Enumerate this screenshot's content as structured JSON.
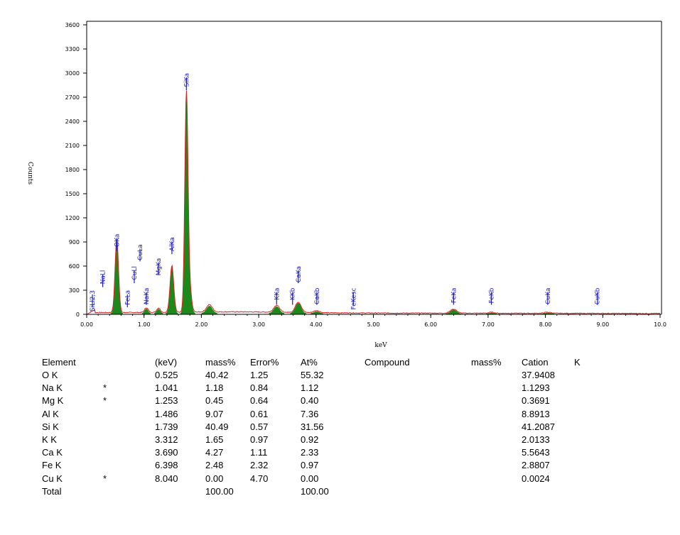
{
  "chart_data": {
    "type": "area",
    "xlabel": "keV",
    "ylabel": "Counts",
    "xlim": [
      0,
      10
    ],
    "ylim": [
      0,
      3600
    ],
    "x_ticks": [
      "0.00",
      "1.00",
      "2.00",
      "3.00",
      "4.00",
      "5.00",
      "6.00",
      "7.00",
      "8.00",
      "9.00",
      "10.0"
    ],
    "y_ticks": [
      "0",
      "300",
      "600",
      "900",
      "1200",
      "1500",
      "1800",
      "2100",
      "2400",
      "2700",
      "3000",
      "3300",
      "3600"
    ],
    "fill_color": "#1b8a1b",
    "line_color": "#e02020",
    "marker_color": "#1a1acc",
    "peaks": [
      {
        "center": 0.525,
        "height": 920,
        "width": 0.03
      },
      {
        "center": 1.041,
        "height": 60,
        "width": 0.03
      },
      {
        "center": 1.253,
        "height": 55,
        "width": 0.03
      },
      {
        "center": 1.486,
        "height": 580,
        "width": 0.032
      },
      {
        "center": 1.739,
        "height": 2720,
        "width": 0.028
      },
      {
        "center": 1.8,
        "height": 260,
        "width": 0.03
      },
      {
        "center": 2.14,
        "height": 90,
        "width": 0.05
      },
      {
        "center": 3.312,
        "height": 85,
        "width": 0.05
      },
      {
        "center": 3.69,
        "height": 130,
        "width": 0.05
      },
      {
        "center": 4.013,
        "height": 25,
        "width": 0.05
      },
      {
        "center": 6.398,
        "height": 50,
        "width": 0.055
      },
      {
        "center": 7.058,
        "height": 12,
        "width": 0.05
      },
      {
        "center": 8.04,
        "height": 14,
        "width": 0.06
      }
    ],
    "line_labels": [
      {
        "label": "SiLl2,3",
        "x": 0.1,
        "y": 300
      },
      {
        "label": "NaLl",
        "x": 0.28,
        "y": 550
      },
      {
        "label": "OKa",
        "x": 0.525,
        "y": 1000
      },
      {
        "label": "FeLa",
        "x": 0.71,
        "y": 300
      },
      {
        "label": "CuLl",
        "x": 0.83,
        "y": 600
      },
      {
        "label": "CuLa",
        "x": 0.93,
        "y": 870
      },
      {
        "label": "NaKa",
        "x": 1.041,
        "y": 330
      },
      {
        "label": "MgKa",
        "x": 1.253,
        "y": 700
      },
      {
        "label": "AlKa",
        "x": 1.486,
        "y": 960
      },
      {
        "label": "SiKa",
        "x": 1.739,
        "y": 3000
      },
      {
        "label": "KKa",
        "x": 3.312,
        "y": 330
      },
      {
        "label": "KKb",
        "x": 3.59,
        "y": 330
      },
      {
        "label": "CaKa",
        "x": 3.69,
        "y": 600
      },
      {
        "label": "CaKb",
        "x": 4.013,
        "y": 330
      },
      {
        "label": "FeKesc",
        "x": 4.65,
        "y": 330
      },
      {
        "label": "FeKa",
        "x": 6.398,
        "y": 330
      },
      {
        "label": "FeKb",
        "x": 7.058,
        "y": 330
      },
      {
        "label": "CuKa",
        "x": 8.04,
        "y": 330
      },
      {
        "label": "CuKb",
        "x": 8.905,
        "y": 330
      }
    ]
  },
  "table": {
    "headers": {
      "element": "Element",
      "kev": "(keV)",
      "mass": "mass%",
      "error": "Error%",
      "at": "At%",
      "compound": "Compound",
      "cmass": "mass%",
      "cation": "Cation",
      "k": "K"
    },
    "rows": [
      {
        "element": "O K",
        "flag": "",
        "kev": "0.525",
        "mass": "40.42",
        "error": "1.25",
        "at": "55.32",
        "cation": "37.9408"
      },
      {
        "element": "Na K",
        "flag": "*",
        "kev": "1.041",
        "mass": "1.18",
        "error": "0.84",
        "at": "1.12",
        "cation": "1.1293"
      },
      {
        "element": "Mg K",
        "flag": "*",
        "kev": "1.253",
        "mass": "0.45",
        "error": "0.64",
        "at": "0.40",
        "cation": "0.3691"
      },
      {
        "element": "Al K",
        "flag": "",
        "kev": "1.486",
        "mass": "9.07",
        "error": "0.61",
        "at": "7.36",
        "cation": "8.8913"
      },
      {
        "element": "Si K",
        "flag": "",
        "kev": "1.739",
        "mass": "40.49",
        "error": "0.57",
        "at": "31.56",
        "cation": "41.2087"
      },
      {
        "element": "K K",
        "flag": "",
        "kev": "3.312",
        "mass": "1.65",
        "error": "0.97",
        "at": "0.92",
        "cation": "2.0133"
      },
      {
        "element": "Ca K",
        "flag": "",
        "kev": "3.690",
        "mass": "4.27",
        "error": "1.11",
        "at": "2.33",
        "cation": "5.5643"
      },
      {
        "element": "Fe K",
        "flag": "",
        "kev": "6.398",
        "mass": "2.48",
        "error": "2.32",
        "at": "0.97",
        "cation": "2.8807"
      },
      {
        "element": "Cu K",
        "flag": "*",
        "kev": "8.040",
        "mass": "0.00",
        "error": "4.70",
        "at": "0.00",
        "cation": "0.0024"
      }
    ],
    "total": {
      "element": "Total",
      "mass": "100.00",
      "at": "100.00"
    }
  }
}
